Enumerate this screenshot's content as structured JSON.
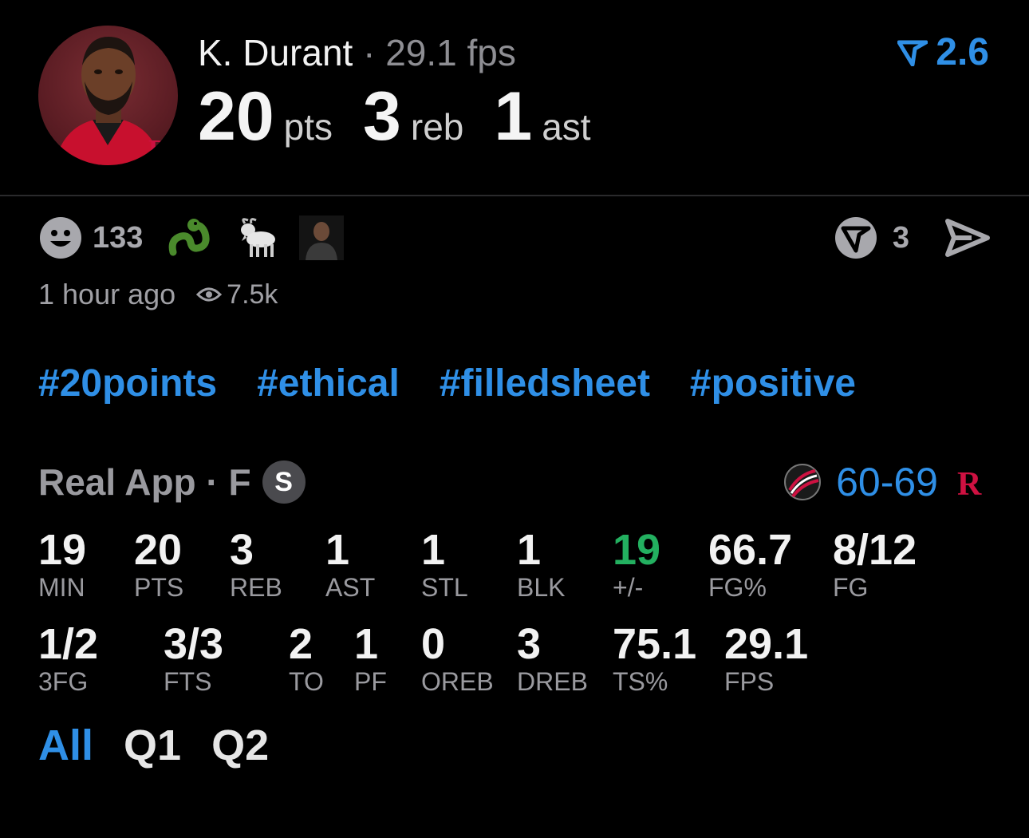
{
  "player": {
    "name": "K. Durant",
    "separator": "·",
    "fps": "29.1 fps",
    "pts_value": "20",
    "pts_unit": "pts",
    "reb_value": "3",
    "reb_unit": "reb",
    "ast_value": "1",
    "ast_unit": "ast",
    "rating": "2.6"
  },
  "reactions": {
    "count": "133",
    "emojis": [
      "snake-icon",
      "goat-icon",
      "person-photo"
    ],
    "comment_count": "3"
  },
  "meta": {
    "time_ago": "1 hour ago",
    "views": "7.5k"
  },
  "hashtags": [
    "#20points",
    "#ethical",
    "#filledsheet",
    "#positive"
  ],
  "game": {
    "source": "Real App · F",
    "badge": "S",
    "score": "60-69"
  },
  "stats_row1": [
    {
      "value": "19",
      "label": "MIN"
    },
    {
      "value": "20",
      "label": "PTS"
    },
    {
      "value": "3",
      "label": "REB"
    },
    {
      "value": "1",
      "label": "AST"
    },
    {
      "value": "1",
      "label": "STL"
    },
    {
      "value": "1",
      "label": "BLK"
    },
    {
      "value": "19",
      "label": "+/-"
    },
    {
      "value": "66.7",
      "label": "FG%"
    },
    {
      "value": "8/12",
      "label": "FG"
    }
  ],
  "stats_row2": [
    {
      "value": "1/2",
      "label": "3FG"
    },
    {
      "value": "3/3",
      "label": "FTS"
    },
    {
      "value": "2",
      "label": "TO"
    },
    {
      "value": "1",
      "label": "PF"
    },
    {
      "value": "0",
      "label": "OREB"
    },
    {
      "value": "3",
      "label": "DREB"
    },
    {
      "value": "75.1",
      "label": "TS%"
    },
    {
      "value": "29.1",
      "label": "FPS"
    }
  ],
  "tabs": [
    "All",
    "Q1",
    "Q2"
  ],
  "colors": {
    "accent": "#2f8fe6",
    "positive": "#23b060",
    "muted": "#9a9a9f",
    "background": "#000000",
    "rockets_red": "#ce1141"
  }
}
